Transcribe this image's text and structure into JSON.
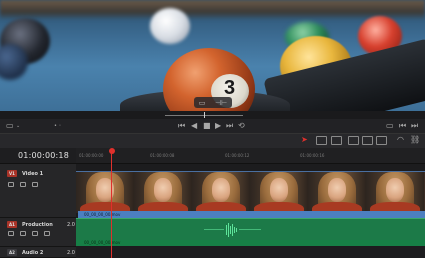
{
  "viewer": {
    "ball_number": "3",
    "overlay_icons": [
      "layout-icon",
      "split-icon"
    ]
  },
  "transport": {
    "left_icons": [
      "monitor-icon",
      "chevron-down-icon",
      "dots-icon"
    ],
    "buttons": [
      "first-frame-icon",
      "prev-frame-icon",
      "stop-icon",
      "play-icon",
      "next-frame-icon",
      "loop-icon"
    ],
    "right_icons": [
      "fullscreen-icon",
      "prev-edit-icon",
      "next-edit-icon"
    ]
  },
  "toolbar": {
    "accent_color": "#e0302c",
    "tools": [
      "selection-icon",
      "trim-icon",
      "blade-icon",
      "insert-icon",
      "overwrite-icon",
      "replace-icon",
      "flag-icon",
      "marker-icon",
      "snap-icon",
      "link-icon"
    ]
  },
  "timeline": {
    "timecode": "01:00:00:18",
    "ruler_ticks": [
      "01:00:00:00",
      "01:00:00:08",
      "01:00:00:12",
      "01:00:00:16"
    ],
    "playhead_color": "#e0302c"
  },
  "tracks": {
    "video1": {
      "tag": "V1",
      "name": "Video 1"
    },
    "production": {
      "tag": "A1",
      "name": "Production",
      "level": "2.0"
    },
    "audio2": {
      "tag": "A2",
      "name": "Audio 2",
      "level": "2.0"
    }
  },
  "clips": {
    "video_clip_name": "00_00_00_00.mov",
    "audio_clip_name": "00_00_00_00.mov",
    "video_color": "#4c7fc0",
    "audio_color": "#1c7a48"
  }
}
